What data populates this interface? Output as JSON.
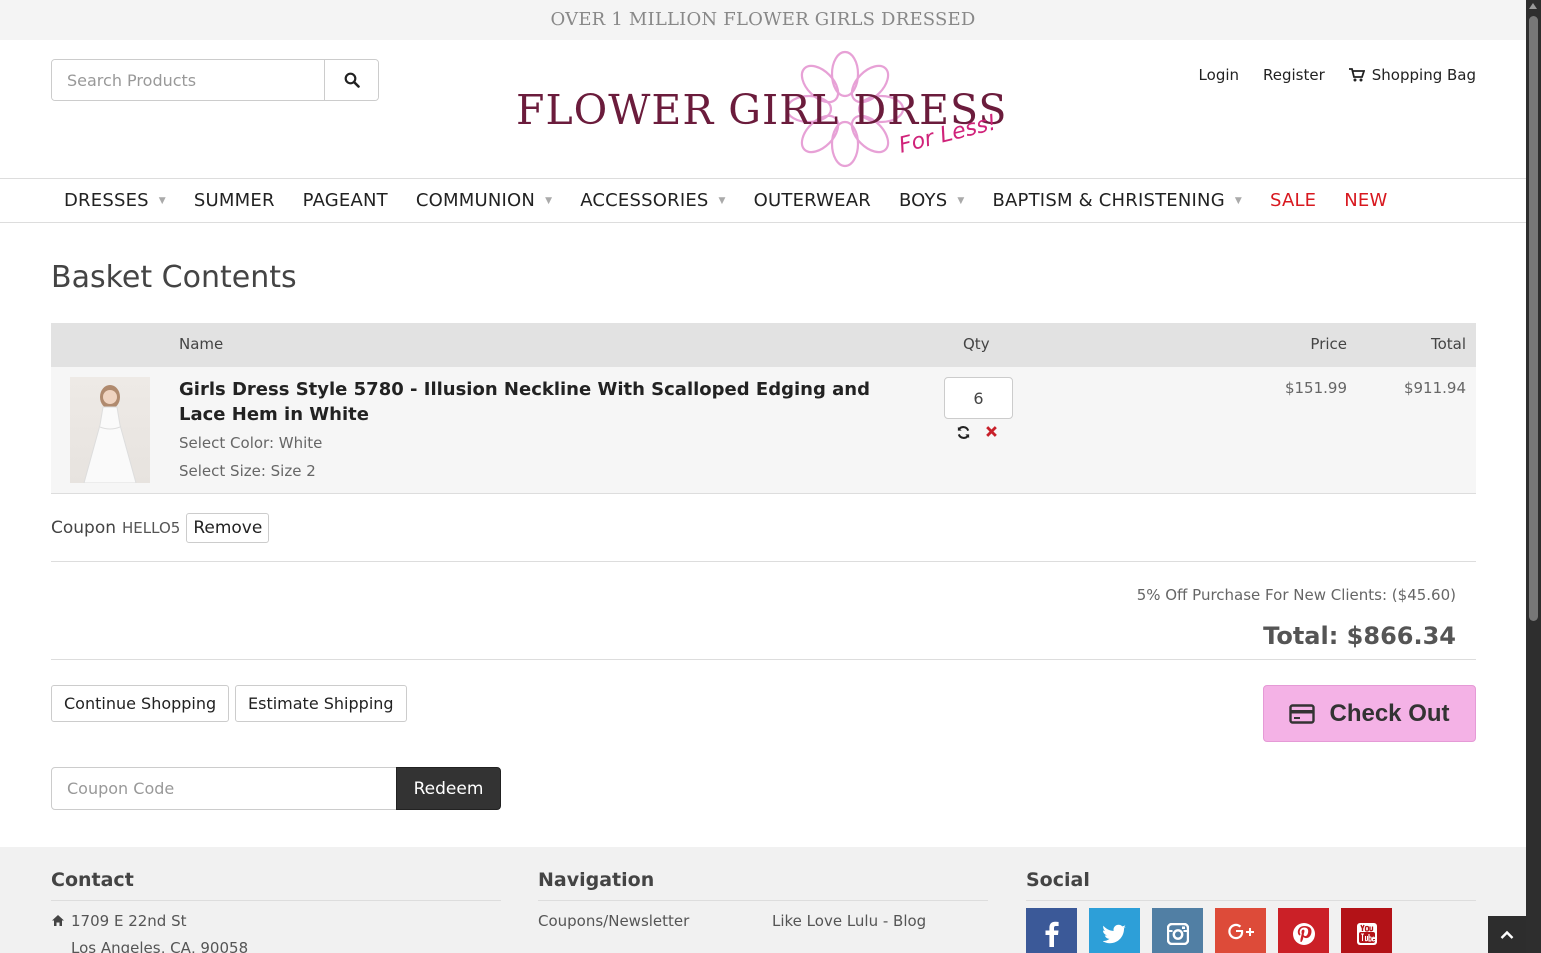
{
  "banner": {
    "text": "OVER 1 MILLION FLOWER GIRLS DRESSED"
  },
  "header": {
    "search_placeholder": "Search Products",
    "logo_text": "FLOWER GIRL DRESS",
    "logo_sub": "For Less!",
    "links": {
      "login": "Login",
      "register": "Register",
      "bag": "Shopping Bag"
    }
  },
  "nav": {
    "items": [
      {
        "label": "DRESSES"
      },
      {
        "label": "SUMMER"
      },
      {
        "label": "PAGEANT"
      },
      {
        "label": "COMMUNION"
      },
      {
        "label": "ACCESSORIES"
      },
      {
        "label": "OUTERWEAR"
      },
      {
        "label": "BOYS"
      },
      {
        "label": "BAPTISM & CHRISTENING"
      },
      {
        "label": "SALE"
      },
      {
        "label": "NEW"
      }
    ]
  },
  "basket": {
    "title": "Basket Contents",
    "columns": {
      "name": "Name",
      "qty": "Qty",
      "price": "Price",
      "total": "Total"
    },
    "item": {
      "name": "Girls Dress Style 5780 - Illusion Neckline With Scalloped Edging and Lace Hem in White",
      "color": "Select Color: White",
      "size": "Select Size: Size 2",
      "qty": "6",
      "price": "$151.99",
      "total": "$911.94"
    },
    "coupon_label": "Coupon",
    "coupon_code": "HELLO5",
    "remove_label": "Remove",
    "discount": "5% Off Purchase For New Clients: ($45.60)",
    "grand_total": "Total: $866.34",
    "continue_label": "Continue Shopping",
    "estimate_label": "Estimate Shipping",
    "checkout_label": "Check Out",
    "coupon_placeholder": "Coupon Code",
    "redeem_label": "Redeem"
  },
  "footer": {
    "contact_title": "Contact",
    "address1": "1709 E 22nd St",
    "address2": "Los Angeles, CA, 90058",
    "navigation_title": "Navigation",
    "nav_link1": "Coupons/Newsletter",
    "nav_link2": "Like Love Lulu - Blog",
    "social_title": "Social"
  },
  "colors": {
    "accent_pink": "#f4b2e6",
    "brand_maroon": "#6b1c3c",
    "sale_red": "#d8181f"
  }
}
